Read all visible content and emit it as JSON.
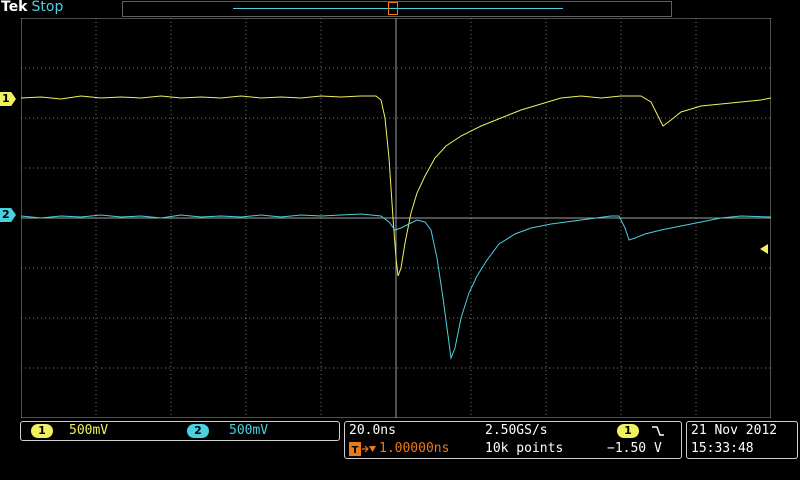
{
  "header": {
    "brand": "Tek",
    "acq_state": "Stop"
  },
  "markers": {
    "ch1": "1",
    "ch2": "2",
    "trigger": "T"
  },
  "channels": [
    {
      "label": "1",
      "scale": "500mV",
      "color": "#f0f060"
    },
    {
      "label": "2",
      "scale": "500mV",
      "color": "#4bd0e0"
    }
  ],
  "timebase": {
    "time_div": "20.0ns",
    "sample_rate": "2.50GS/s",
    "trigger_delay": "1.00000ns",
    "record_length": "10k points",
    "trigger_source": "1",
    "trigger_slope": "falling",
    "trigger_level": "−1.50 V"
  },
  "datetime": {
    "date": "21 Nov 2012",
    "time": "15:33:48"
  },
  "colors": {
    "grid": "#7a7a7a",
    "ch1": "#f0f060",
    "ch2": "#4bd0e0",
    "trigger": "#e87a1a"
  }
}
